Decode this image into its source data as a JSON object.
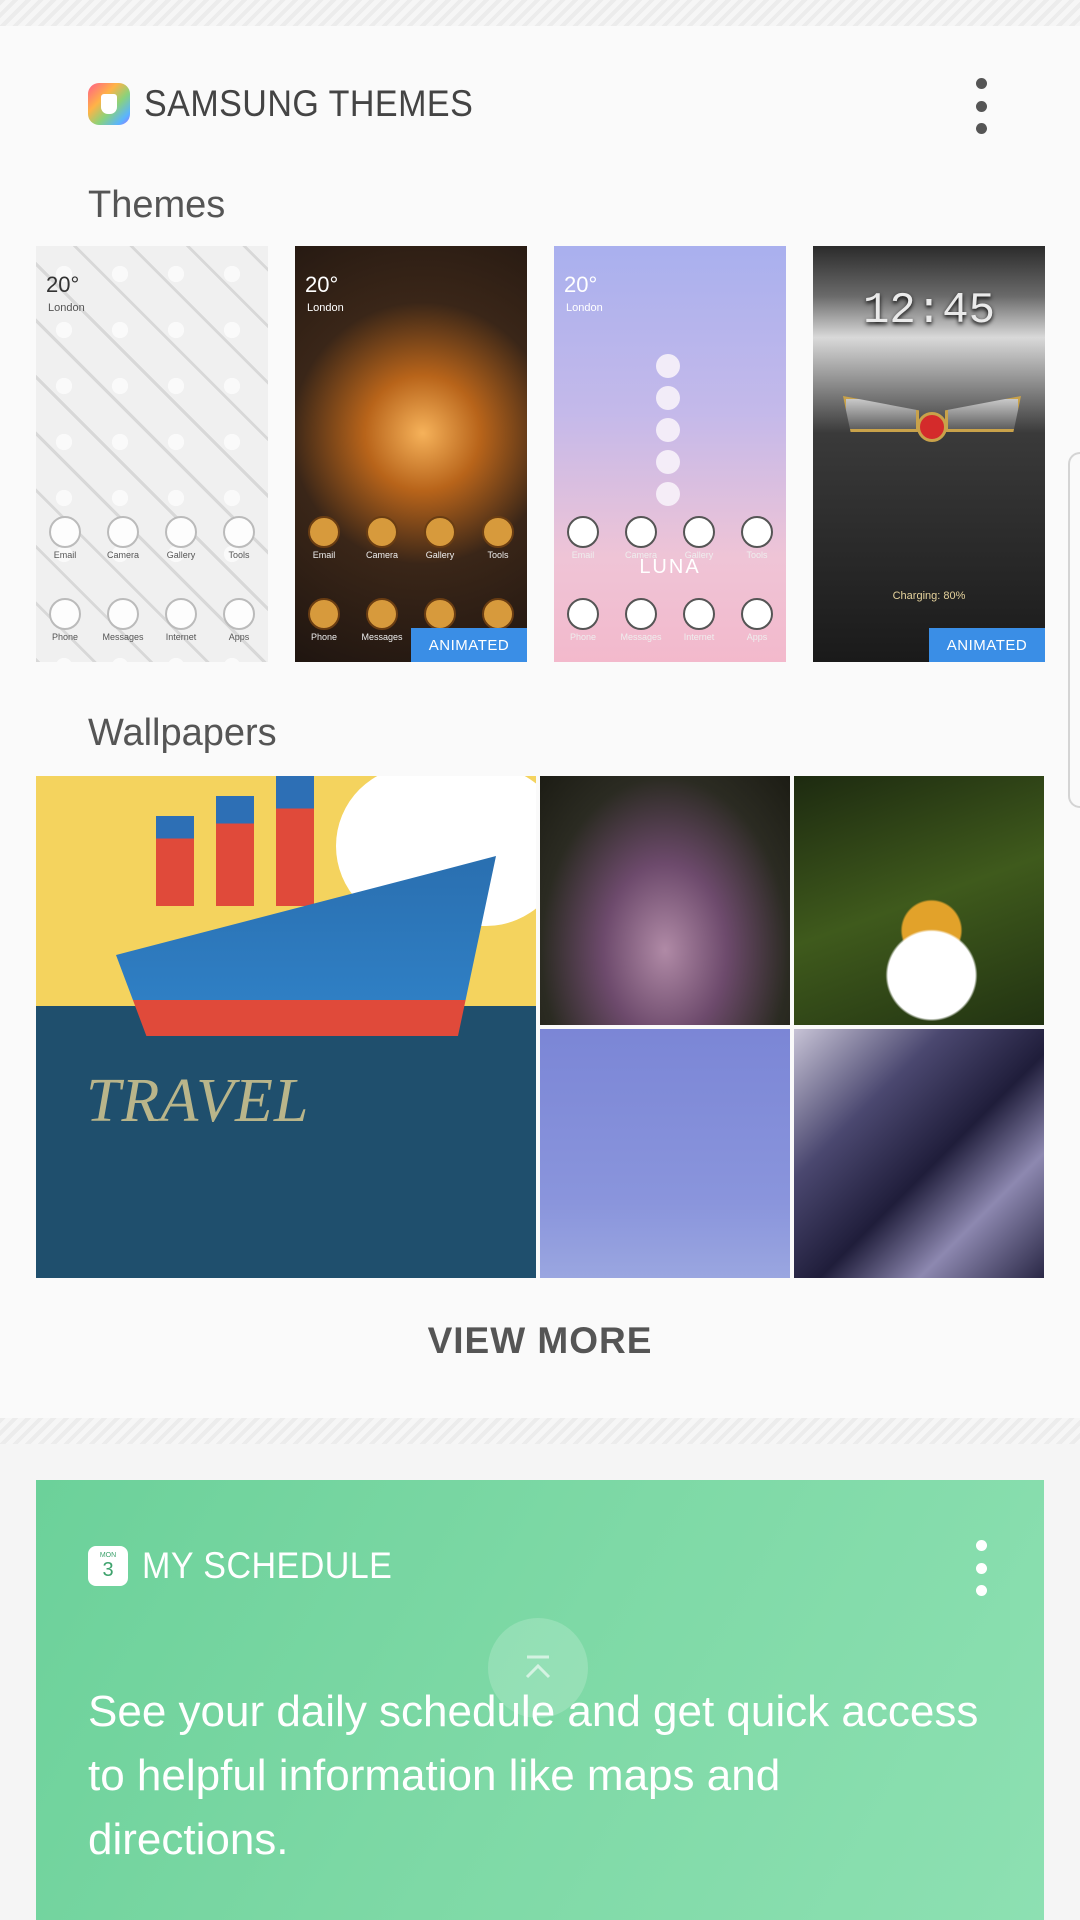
{
  "themes_card": {
    "title": "SAMSUNG THEMES",
    "themes_section_title": "Themes",
    "themes": [
      {
        "weather": "20°",
        "city": "London",
        "apps_top": [
          "Email",
          "Camera",
          "Gallery",
          "Tools"
        ],
        "apps_bottom": [
          "Phone",
          "Messages",
          "Internet",
          "Apps"
        ],
        "badge": ""
      },
      {
        "weather": "20°",
        "city": "London",
        "apps_top": [
          "Email",
          "Camera",
          "Gallery",
          "Tools"
        ],
        "apps_bottom": [
          "Phone",
          "Messages",
          "",
          ""
        ],
        "badge": "ANIMATED"
      },
      {
        "weather": "20°",
        "city": "London",
        "apps_top": [
          "Email",
          "Camera",
          "Gallery",
          "Tools"
        ],
        "apps_bottom": [
          "Phone",
          "Messages",
          "Internet",
          "Apps"
        ],
        "center_text": "LUNA",
        "badge": ""
      },
      {
        "clock": "12:45",
        "status": "Charging: 80%",
        "badge": "ANIMATED"
      }
    ],
    "wallpapers_section_title": "Wallpapers",
    "wallpapers": [
      {
        "name": "travel-ship",
        "text": "TRAVEL"
      },
      {
        "name": "girl-in-dress"
      },
      {
        "name": "honey-bee"
      },
      {
        "name": "blue-sky"
      },
      {
        "name": "glass-shards"
      }
    ],
    "view_more_label": "VIEW MORE"
  },
  "schedule_card": {
    "icon_month": "MON",
    "icon_day": "3",
    "title": "MY SCHEDULE",
    "body": "See your daily schedule and get quick access to helpful information like maps and directions."
  },
  "colors": {
    "animated_badge": "#3a8ee6",
    "schedule_card": "#7ed9a6"
  }
}
